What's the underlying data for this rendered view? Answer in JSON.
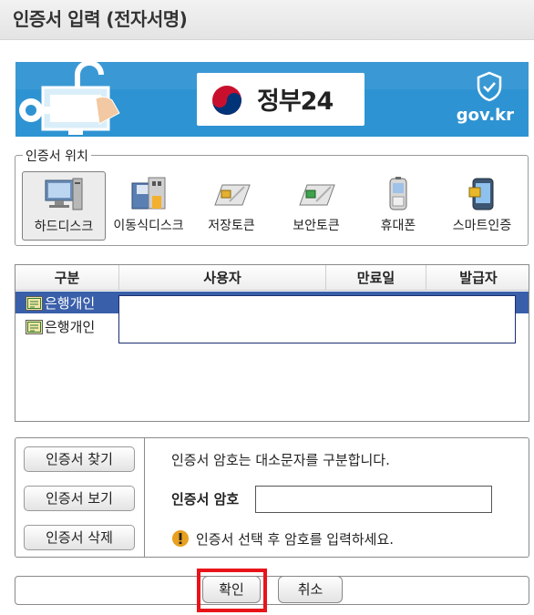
{
  "window": {
    "title": "인증서 입력 (전자서명)"
  },
  "banner": {
    "gov_name": "정부24",
    "domain": "gov.kr",
    "accent_color": "#2e93d2",
    "icons": [
      "unlock-key-computer-icon",
      "taegeuk-emblem-icon",
      "shield-check-icon"
    ]
  },
  "location": {
    "legend": "인증서 위치",
    "items": [
      {
        "label": "하드디스크",
        "icon": "hard-disk-icon",
        "selected": true
      },
      {
        "label": "이동식디스크",
        "icon": "removable-disk-icon",
        "selected": false
      },
      {
        "label": "저장토큰",
        "icon": "storage-token-icon",
        "selected": false
      },
      {
        "label": "보안토큰",
        "icon": "security-token-icon",
        "selected": false
      },
      {
        "label": "휴대폰",
        "icon": "mobile-phone-icon",
        "selected": false
      },
      {
        "label": "스마트인증",
        "icon": "smart-auth-icon",
        "selected": false
      }
    ]
  },
  "cert_table": {
    "columns": [
      "구분",
      "사용자",
      "만료일",
      "발급자"
    ],
    "rows": [
      {
        "type": "은행개인",
        "selected": true
      },
      {
        "type": "은행개인",
        "selected": false
      }
    ],
    "selected_row_color": "#3a5faa"
  },
  "actions": {
    "find": "인증서 찾기",
    "view": "인증서 보기",
    "delete": "인증서 삭제"
  },
  "password": {
    "info": "인증서 암호는 대소문자를 구분합니다.",
    "label": "인증서 암호",
    "value": "",
    "warning": "인증서 선택 후 암호를 입력하세요."
  },
  "footer": {
    "ok": "확인",
    "cancel": "취소",
    "highlight_color": "#e8141a"
  }
}
